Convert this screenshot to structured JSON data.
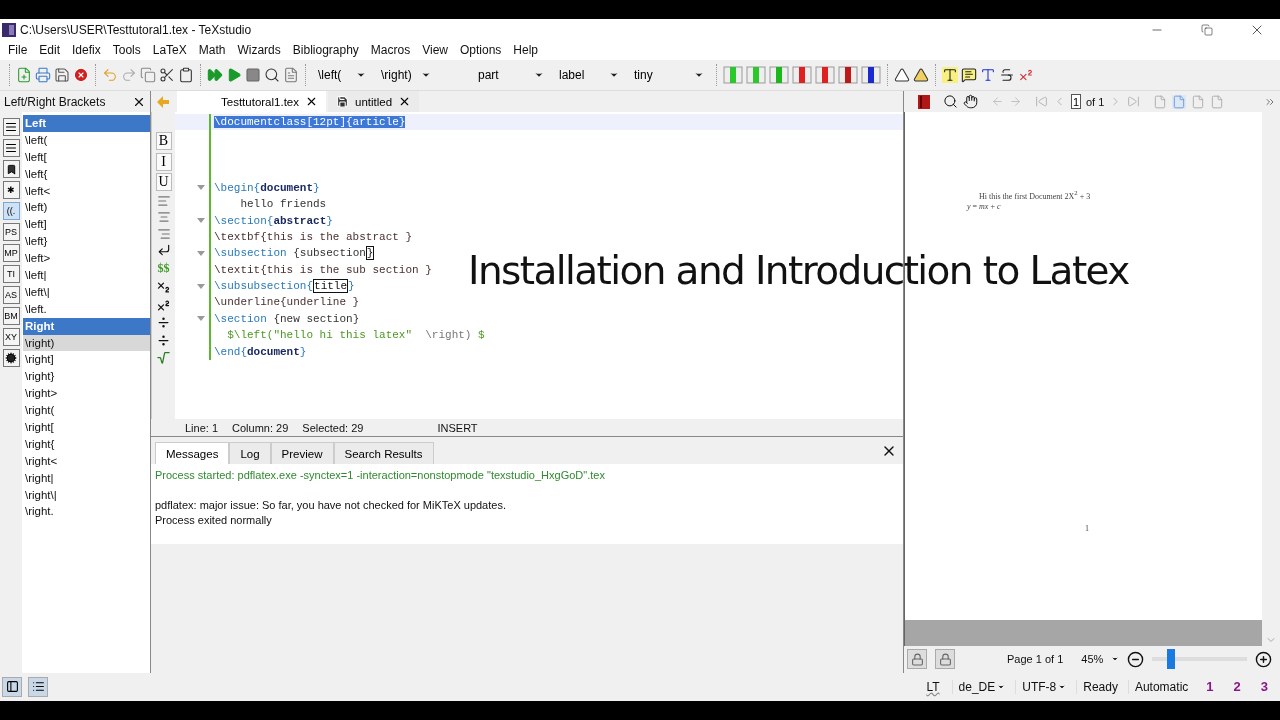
{
  "window": {
    "title": "C:\\Users\\USER\\Testtutoral1.tex - TeXstudio"
  },
  "menu": [
    "File",
    "Edit",
    "Idefix",
    "Tools",
    "LaTeX",
    "Math",
    "Wizards",
    "Bibliography",
    "Macros",
    "View",
    "Options",
    "Help"
  ],
  "toolbar": {
    "dropdowns": [
      "\\left(",
      "\\right)",
      "part",
      "label",
      "tiny"
    ]
  },
  "side_panel": {
    "title": "Left/Right Brackets",
    "tools": [
      {
        "kind": "lines",
        "selected": false
      },
      {
        "kind": "lines",
        "selected": false
      },
      {
        "kind": "bookmark",
        "selected": false
      },
      {
        "kind": "text",
        "label": "✱",
        "selected": false
      },
      {
        "kind": "text",
        "label": "((.",
        "selected": true
      },
      {
        "kind": "text",
        "label": "PS",
        "selected": false
      },
      {
        "kind": "text",
        "label": "MP",
        "selected": false
      },
      {
        "kind": "text",
        "label": "TI",
        "selected": false
      },
      {
        "kind": "text",
        "label": "AS",
        "selected": false
      },
      {
        "kind": "text",
        "label": "BM",
        "selected": false
      },
      {
        "kind": "text",
        "label": "XY",
        "selected": false
      },
      {
        "kind": "gears",
        "selected": false
      }
    ],
    "items": [
      {
        "label": "Left",
        "kind": "header"
      },
      {
        "label": "\\left(",
        "kind": "item",
        "selected": false
      },
      {
        "label": "\\left[",
        "kind": "item",
        "selected": false
      },
      {
        "label": "\\left{",
        "kind": "item",
        "selected": false
      },
      {
        "label": "\\left<",
        "kind": "item",
        "selected": false
      },
      {
        "label": "\\left)",
        "kind": "item",
        "selected": false
      },
      {
        "label": "\\left]",
        "kind": "item",
        "selected": false
      },
      {
        "label": "\\left}",
        "kind": "item",
        "selected": false
      },
      {
        "label": "\\left>",
        "kind": "item",
        "selected": false
      },
      {
        "label": "\\left|",
        "kind": "item",
        "selected": false
      },
      {
        "label": "\\left\\|",
        "kind": "item",
        "selected": false
      },
      {
        "label": "\\left.",
        "kind": "item",
        "selected": false
      },
      {
        "label": "Right",
        "kind": "header"
      },
      {
        "label": "\\right)",
        "kind": "item",
        "selected": true
      },
      {
        "label": "\\right]",
        "kind": "item",
        "selected": false
      },
      {
        "label": "\\right}",
        "kind": "item",
        "selected": false
      },
      {
        "label": "\\right>",
        "kind": "item",
        "selected": false
      },
      {
        "label": "\\right(",
        "kind": "item",
        "selected": false
      },
      {
        "label": "\\right[",
        "kind": "item",
        "selected": false
      },
      {
        "label": "\\right{",
        "kind": "item",
        "selected": false
      },
      {
        "label": "\\right<",
        "kind": "item",
        "selected": false
      },
      {
        "label": "\\right|",
        "kind": "item",
        "selected": false
      },
      {
        "label": "\\right\\|",
        "kind": "item",
        "selected": false
      },
      {
        "label": "\\right.",
        "kind": "item",
        "selected": false
      }
    ]
  },
  "editor": {
    "tabs": [
      {
        "label": "Testtutoral1.tex",
        "selected": true,
        "modified": false
      },
      {
        "label": "untitled",
        "selected": false,
        "modified": true
      }
    ],
    "format_tools": [
      {
        "kind": "text",
        "label": "B"
      },
      {
        "kind": "text",
        "label": "I"
      },
      {
        "kind": "text",
        "label": "U"
      },
      {
        "kind": "align-left"
      },
      {
        "kind": "align-center"
      },
      {
        "kind": "align-right"
      },
      {
        "kind": "return"
      },
      {
        "kind": "text",
        "label": "$$"
      },
      {
        "kind": "subscript"
      },
      {
        "kind": "superscript"
      },
      {
        "kind": "fraction"
      },
      {
        "kind": "fraction"
      },
      {
        "kind": "sqrt"
      }
    ],
    "lines": [
      {
        "kind": "code",
        "selected": true,
        "foldable": false,
        "segments": [
          {
            "kind": "plain",
            "text": "\\documentclass[12pt]{article}"
          }
        ]
      },
      {
        "kind": "blank"
      },
      {
        "kind": "blank"
      },
      {
        "kind": "blank"
      },
      {
        "kind": "code",
        "selected": false,
        "foldable": true,
        "segments": [
          {
            "kind": "cmd",
            "text": "\\begin{"
          },
          {
            "kind": "arg",
            "text": "document"
          },
          {
            "kind": "cmd",
            "text": "}"
          }
        ]
      },
      {
        "kind": "code",
        "selected": false,
        "foldable": false,
        "segments": [
          {
            "kind": "text",
            "text": "    hello friends"
          }
        ]
      },
      {
        "kind": "code",
        "selected": false,
        "foldable": true,
        "segments": [
          {
            "kind": "cmd",
            "text": "\\section{"
          },
          {
            "kind": "arg",
            "text": "abstract"
          },
          {
            "kind": "cmd",
            "text": "}"
          }
        ]
      },
      {
        "kind": "code",
        "selected": false,
        "foldable": false,
        "segments": [
          {
            "kind": "plain",
            "text": "\\textbf{this is the abstract }"
          }
        ]
      },
      {
        "kind": "code",
        "selected": false,
        "foldable": true,
        "segments": [
          {
            "kind": "cmd",
            "text": "\\subsection "
          },
          {
            "kind": "text",
            "text": "{subsection"
          },
          {
            "kind": "match",
            "text": "}"
          }
        ]
      },
      {
        "kind": "code",
        "selected": false,
        "foldable": false,
        "segments": [
          {
            "kind": "plain",
            "text": "\\textit{this is the sub section }"
          }
        ]
      },
      {
        "kind": "code",
        "selected": false,
        "foldable": true,
        "segments": [
          {
            "kind": "cmd",
            "text": "\\subsubsection{"
          },
          {
            "kind": "match",
            "text": "title"
          },
          {
            "kind": "cmd",
            "text": "}"
          }
        ]
      },
      {
        "kind": "code",
        "selected": false,
        "foldable": false,
        "segments": [
          {
            "kind": "plain",
            "text": "\\underline{underline }"
          }
        ]
      },
      {
        "kind": "code",
        "selected": false,
        "foldable": true,
        "segments": [
          {
            "kind": "cmd",
            "text": "\\section "
          },
          {
            "kind": "text",
            "text": "{new section}"
          }
        ]
      },
      {
        "kind": "code",
        "selected": false,
        "foldable": false,
        "segments": [
          {
            "kind": "math",
            "text": "  $\\left(\"hello hi this latex\"  "
          },
          {
            "kind": "mathcmd",
            "text": "\\right)"
          },
          {
            "kind": "math",
            "text": " $"
          }
        ]
      },
      {
        "kind": "code",
        "selected": false,
        "foldable": false,
        "segments": [
          {
            "kind": "cmd",
            "text": "\\end{"
          },
          {
            "kind": "arg",
            "text": "document"
          },
          {
            "kind": "cmd",
            "text": "}"
          }
        ]
      }
    ],
    "status": [
      "Line: 1",
      "Column: 29",
      "Selected: 29",
      "INSERT"
    ]
  },
  "output": {
    "tabs": [
      {
        "label": "Messages",
        "selected": true
      },
      {
        "label": "Log",
        "selected": false
      },
      {
        "label": "Preview",
        "selected": false
      },
      {
        "label": "Search Results",
        "selected": false
      }
    ],
    "messages": [
      {
        "kind": "started",
        "text": "Process started: pdflatex.exe -synctex=1 -interaction=nonstopmode \"texstudio_HxgGoD\".tex"
      },
      {
        "kind": "info",
        "text": "pdflatex: major issue: So far, you have not checked for MiKTeX updates."
      },
      {
        "kind": "plain",
        "text": "Process exited normally"
      }
    ]
  },
  "pdf_viewer": {
    "page_input": "1",
    "page_of": "of 1",
    "page_lines": [
      "Hi this the first Document 2X$^{2}$ + 3",
      "*y* = *mx* + *c*"
    ],
    "page_number": "1",
    "page_label": "Page 1 of 1",
    "zoom": "45%",
    "level": 0.2
  },
  "status_bar": {
    "lt": "LT",
    "items": [
      "de_DE",
      "UTF-8",
      "Ready",
      "Automatic"
    ],
    "dropdown": [
      true,
      true,
      false,
      false
    ],
    "bookmarks": [
      "1",
      "2",
      "3"
    ]
  },
  "overlay_title": "Installation and Introduction to Latex"
}
